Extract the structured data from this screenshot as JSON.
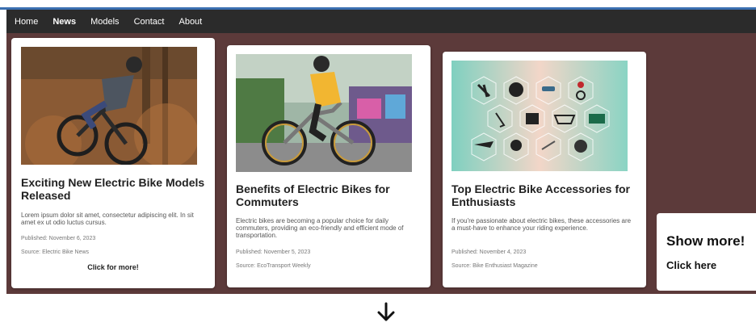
{
  "nav": {
    "items": [
      {
        "label": "Home",
        "active": false
      },
      {
        "label": "News",
        "active": true
      },
      {
        "label": "Models",
        "active": false
      },
      {
        "label": "Contact",
        "active": false
      },
      {
        "label": "About",
        "active": false
      }
    ]
  },
  "cards": [
    {
      "title": "Exciting New Electric Bike Models Released",
      "description": "Lorem ipsum dolor sit amet, consectetur adipiscing elit. In sit amet ex ut odio luctus cursus.",
      "published": "Published: November 6, 2023",
      "source": "Source: Electric Bike News",
      "cta": "Click for more!"
    },
    {
      "title": "Benefits of Electric Bikes for Commuters",
      "description": "Electric bikes are becoming a popular choice for daily commuters, providing an eco-friendly and efficient mode of transportation.",
      "published": "Published: November 5, 2023",
      "source": "Source: EcoTransport Weekly"
    },
    {
      "title": "Top Electric Bike Accessories for Enthusiasts",
      "description": "If you're passionate about electric bikes, these accessories are a must-have to enhance your riding experience.",
      "published": "Published: November 4, 2023",
      "source": "Source: Bike Enthusiast Magazine"
    }
  ],
  "show_more": {
    "title": "Show more!",
    "link": "Click here"
  },
  "icons": {
    "scroll": "arrow-down-icon"
  },
  "colors": {
    "nav_bg": "#2b2b2b",
    "main_bg": "#5c3a3a",
    "accent_line": "#3b6fb0"
  }
}
